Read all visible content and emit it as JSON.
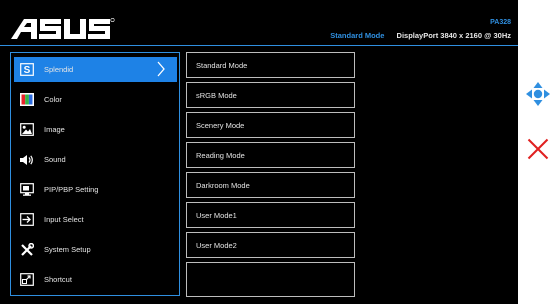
{
  "header": {
    "model": "PA328",
    "mode": "Standard Mode",
    "input_info": "DisplayPort  3840 x 2160 @ 30Hz",
    "logo_text": "ASUS"
  },
  "menu": {
    "items": [
      {
        "label": "Splendid",
        "icon": "splendid-icon",
        "selected": true
      },
      {
        "label": "Color",
        "icon": "color-icon"
      },
      {
        "label": "Image",
        "icon": "image-icon"
      },
      {
        "label": "Sound",
        "icon": "speaker-icon"
      },
      {
        "label": "PIP/PBP Setting",
        "icon": "pip-icon"
      },
      {
        "label": "Input Select",
        "icon": "input-select-icon"
      },
      {
        "label": "System Setup",
        "icon": "tools-icon"
      },
      {
        "label": "Shortcut",
        "icon": "shortcut-icon"
      }
    ]
  },
  "submenu": {
    "items": [
      "Standard Mode",
      "sRGB Mode",
      "Scenery Mode",
      "Reading Mode",
      "Darkroom Mode",
      "User Mode1",
      "User Mode2",
      ""
    ]
  },
  "colors": {
    "accent": "#1e82e6",
    "exit": "#e02020",
    "nav": "#2f8fe0"
  }
}
